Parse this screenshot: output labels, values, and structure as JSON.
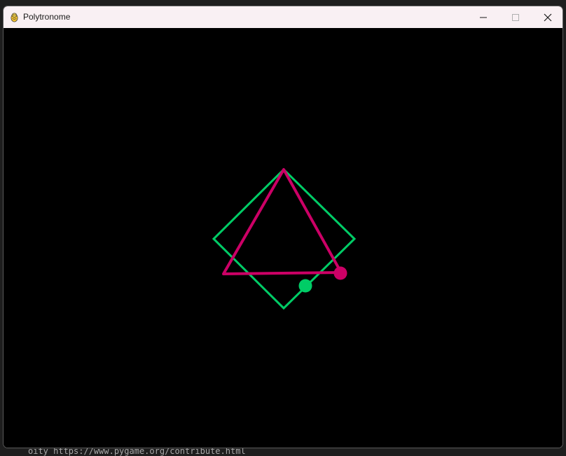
{
  "window": {
    "title": "Polytronome",
    "app_icon": "pygame-snake-icon",
    "controls": {
      "minimize_icon": "minimize-icon",
      "maximize_icon": "maximize-icon",
      "close_icon": "close-icon"
    }
  },
  "background_terminal": {
    "text": "oity  https://www.pygame.org/contribute.html"
  },
  "canvas": {
    "background_color": "#000000",
    "shapes": [
      {
        "name": "square",
        "sides": 4,
        "color": "#00cc66",
        "marker_color": "#00cc66"
      },
      {
        "name": "triangle",
        "sides": 3,
        "color": "#cc0066",
        "marker_color": "#cc0066"
      }
    ]
  },
  "colors": {
    "titlebar": "#f9f0f3",
    "square": "#00cc66",
    "triangle": "#cc0066"
  }
}
